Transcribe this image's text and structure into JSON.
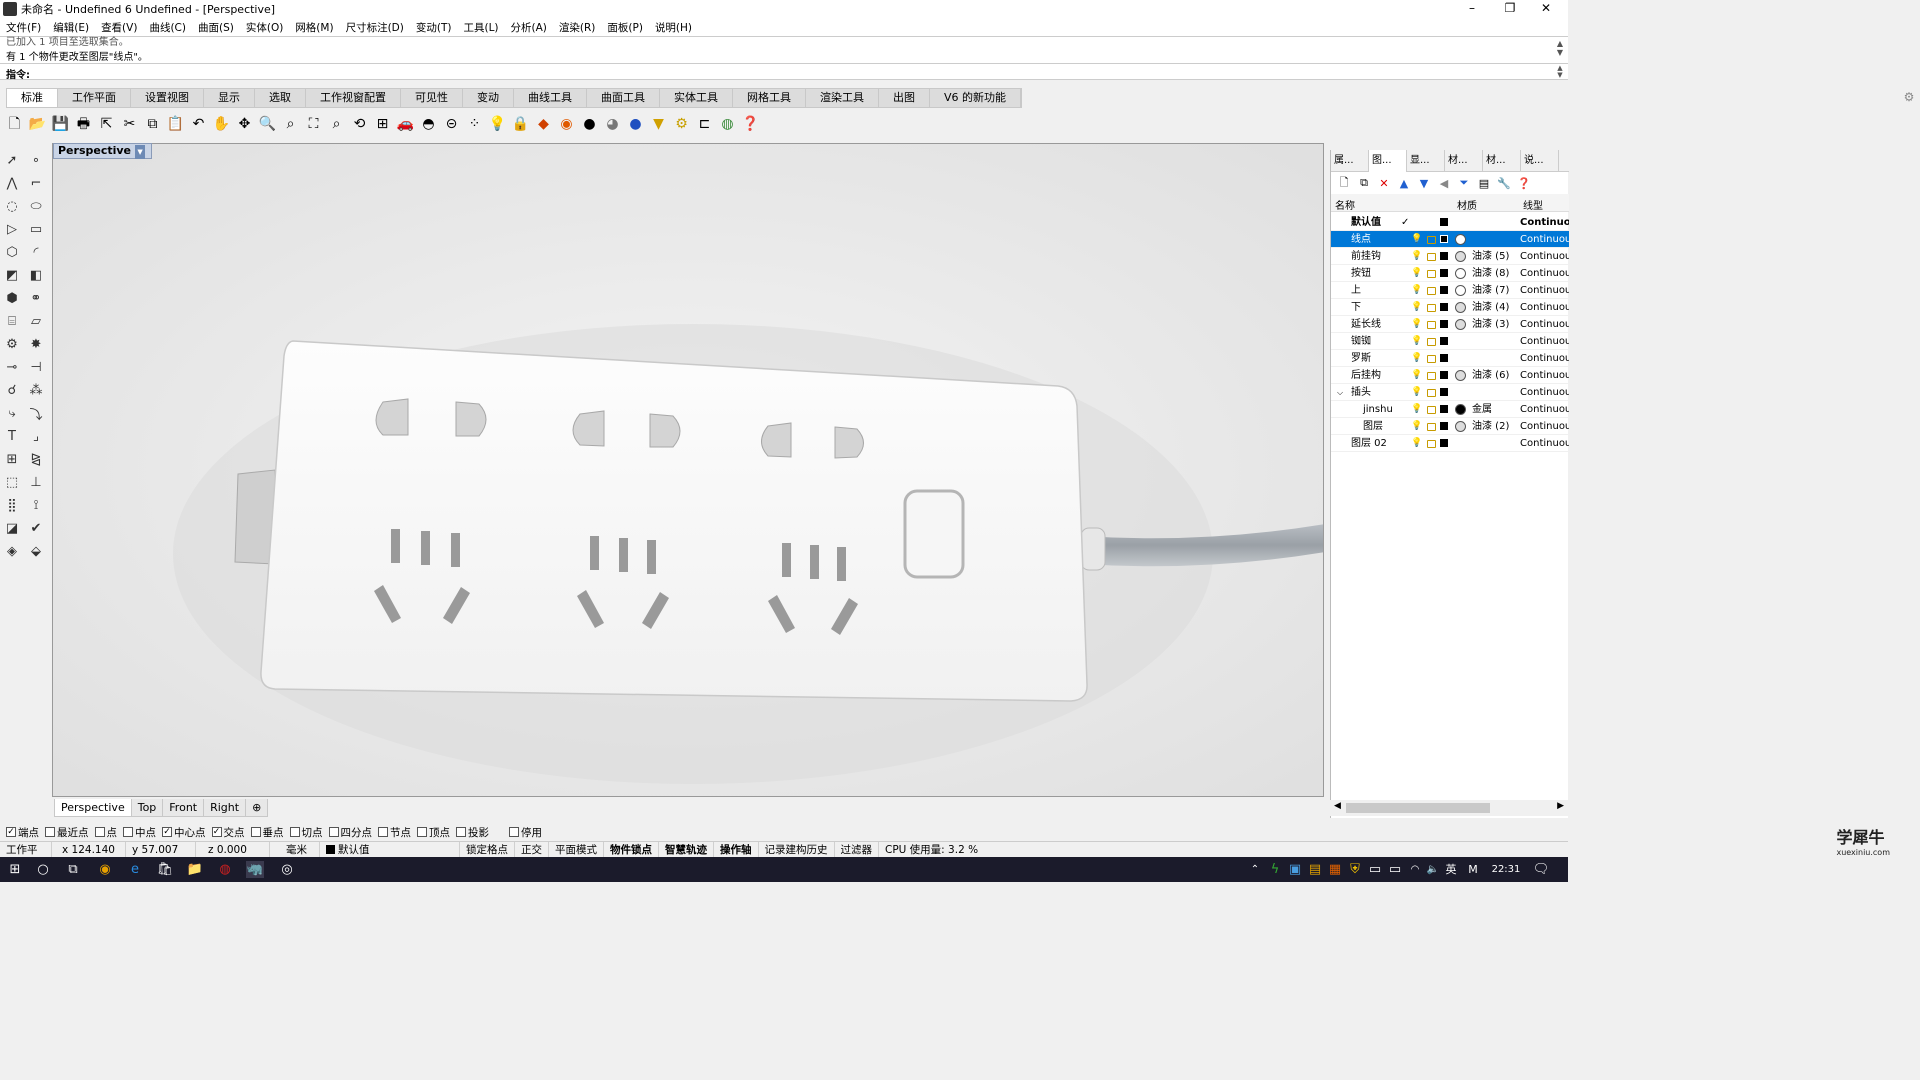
{
  "window": {
    "title": "未命名 - Undefined 6 Undefined - [Perspective]",
    "min": "–",
    "max": "❐",
    "close": "✕"
  },
  "menu": [
    "文件(F)",
    "编辑(E)",
    "查看(V)",
    "曲线(C)",
    "曲面(S)",
    "实体(O)",
    "网格(M)",
    "尺寸标注(D)",
    "变动(T)",
    "工具(L)",
    "分析(A)",
    "渲染(R)",
    "面板(P)",
    "说明(H)"
  ],
  "command": {
    "history_partial": "已加入 1 项目至选取集合。",
    "history": "有 1 个物件更改至图层\"线点\"。",
    "prompt": "指令:"
  },
  "tabs": [
    "标准",
    "工作平面",
    "设置视图",
    "显示",
    "选取",
    "工作视窗配置",
    "可见性",
    "变动",
    "曲线工具",
    "曲面工具",
    "实体工具",
    "网格工具",
    "渲染工具",
    "出图",
    "V6 的新功能"
  ],
  "active_tab": "标准",
  "viewport": {
    "label": "Perspective"
  },
  "viewport_tabs": [
    "Perspective",
    "Top",
    "Front",
    "Right",
    "⊕"
  ],
  "panel": {
    "tabs": [
      "属...",
      "图...",
      "显...",
      "材...",
      "材...",
      "说..."
    ],
    "columns": {
      "name": "名称",
      "material": "材质",
      "linetype": "线型"
    },
    "default_row": {
      "name": "默认值",
      "check": "✓",
      "linetype": "Continuous"
    },
    "layers": [
      {
        "name": "线点",
        "material": "",
        "linetype": "Continuous",
        "ball": "white",
        "selected": true
      },
      {
        "name": "前挂钩",
        "material": "油漆 (5)",
        "linetype": "Continuous",
        "ball": "grey"
      },
      {
        "name": "按钮",
        "material": "油漆 (8)",
        "linetype": "Continuous",
        "ball": "white"
      },
      {
        "name": "上",
        "material": "油漆 (7)",
        "linetype": "Continuous",
        "ball": "white"
      },
      {
        "name": "下",
        "material": "油漆 (4)",
        "linetype": "Continuous",
        "ball": "grey"
      },
      {
        "name": "延长线",
        "material": "油漆 (3)",
        "linetype": "Continuous",
        "ball": "grey"
      },
      {
        "name": "铷铷",
        "material": "",
        "linetype": "Continuous",
        "ball": "none"
      },
      {
        "name": "罗斯",
        "material": "",
        "linetype": "Continuous",
        "ball": "none"
      },
      {
        "name": "后挂构",
        "material": "油漆 (6)",
        "linetype": "Continuous",
        "ball": "grey"
      },
      {
        "name": "插头",
        "material": "",
        "linetype": "Continuous",
        "ball": "none",
        "expanded": true
      },
      {
        "name": "jinshu",
        "material": "金属",
        "linetype": "Continuous",
        "ball": "black",
        "child": true
      },
      {
        "name": "图层",
        "material": "油漆 (2)",
        "linetype": "Continuous",
        "ball": "grey",
        "child": true
      },
      {
        "name": "图层 02",
        "material": "",
        "linetype": "Continuous",
        "ball": "none"
      }
    ]
  },
  "osnaps": [
    {
      "label": "端点",
      "checked": true
    },
    {
      "label": "最近点",
      "checked": false
    },
    {
      "label": "点",
      "checked": false
    },
    {
      "label": "中点",
      "checked": false
    },
    {
      "label": "中心点",
      "checked": true
    },
    {
      "label": "交点",
      "checked": true
    },
    {
      "label": "垂点",
      "checked": false
    },
    {
      "label": "切点",
      "checked": false
    },
    {
      "label": "四分点",
      "checked": false
    },
    {
      "label": "节点",
      "checked": false
    },
    {
      "label": "顶点",
      "checked": false
    },
    {
      "label": "投影",
      "checked": false
    },
    {
      "label": "停用",
      "checked": false
    }
  ],
  "status": {
    "cplane": "工作平面",
    "x": "x 124.140",
    "y": "y 57.007",
    "z": "z 0.000",
    "unit": "毫米",
    "layer": "默认值",
    "toggles": [
      "锁定格点",
      "正交",
      "平面模式",
      "物件锁点",
      "智慧轨迹",
      "操作轴",
      "记录建构历史",
      "过滤器"
    ],
    "cpu": "CPU 使用量: 3.2 %"
  },
  "logo": {
    "text": "学犀牛",
    "sub": "xuexiniu.com"
  },
  "taskbar": {
    "time": "22:31",
    "ime": "英"
  }
}
